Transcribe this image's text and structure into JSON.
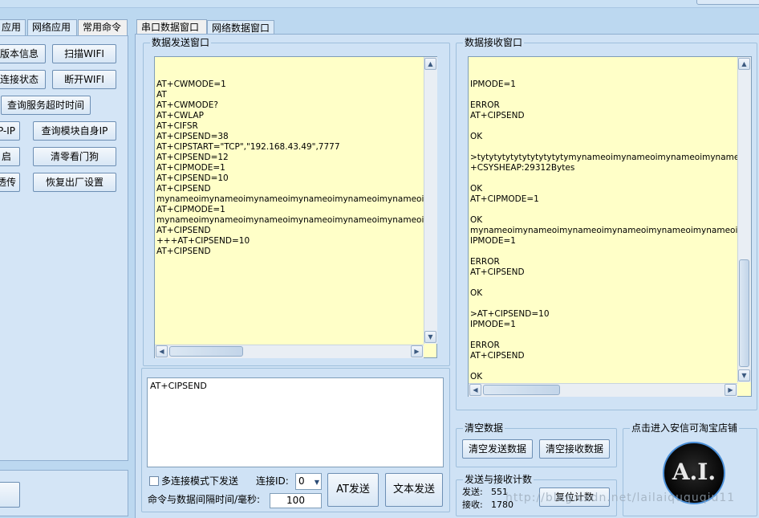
{
  "left_tabs": [
    "应用",
    "网络应用",
    "常用命令"
  ],
  "left_buttons": [
    "版本信息",
    "扫描WIFI",
    "连接状态",
    "断开WIFI",
    "查询服务超时时间",
    "P-IP",
    "查询模块自身IP",
    "启",
    "清零看门狗",
    "透传",
    "恢复出厂设置"
  ],
  "main_tabs": [
    "串口数据窗口",
    "网络数据窗口"
  ],
  "send_group": {
    "title": "数据发送窗口",
    "lines": [
      "AT+CWMODE=1",
      "AT",
      "AT+CWMODE?",
      "AT+CWLAP",
      "AT+CIFSR",
      "AT+CIPSEND=38",
      "AT+CIPSTART=\"TCP\",\"192.168.43.49\",7777",
      "AT+CIPSEND=12",
      "AT+CIPMODE=1",
      "AT+CIPSEND=10",
      "AT+CIPSEND",
      "mynameoimynameoimynameoimynameoimynameoimynameoi+++mynam",
      "AT+CIPMODE=1",
      "mynameoimynameoimynameoimynameoimynameoimynameoi",
      "AT+CIPSEND",
      "+++AT+CIPSEND=10",
      "AT+CIPSEND",
      ""
    ]
  },
  "receive_group": {
    "title": "数据接收窗口",
    "lines": [
      "IPMODE=1",
      "",
      "ERROR",
      "AT+CIPSEND",
      "",
      "OK",
      "",
      ">tytytytytytytytytytytymynameoimynameoimynameoimynameoimyname",
      "+CSYSHEAP:29312Bytes",
      "",
      "OK",
      "AT+CIPMODE=1",
      "",
      "OK",
      "mynameoimynameoimynameoimynameoimynameoimynameoimynameoi",
      "IPMODE=1",
      "",
      "ERROR",
      "AT+CIPSEND",
      "",
      "OK",
      "",
      ">AT+CIPSEND=10",
      "IPMODE=1",
      "",
      "ERROR",
      "AT+CIPSEND",
      "",
      "OK",
      "",
      "",
      ">"
    ]
  },
  "command_box": {
    "value": "AT+CIPSEND"
  },
  "multi_conn": {
    "label": "多连接模式下发送",
    "checked": false
  },
  "conn_id": {
    "label": "连接ID:",
    "value": "0"
  },
  "interval": {
    "label": "命令与数据间隔时间/毫秒:",
    "value": "100"
  },
  "buttons": {
    "at_send": "AT发送",
    "text_send": "文本发送",
    "clear_send": "清空发送数据",
    "clear_recv": "清空接收数据",
    "reset_count": "复位计数"
  },
  "clear_group": {
    "title": "清空数据"
  },
  "count_group": {
    "title": "发送与接收计数",
    "send_label": "发送:",
    "send_value": "551",
    "recv_label": "接收:",
    "recv_value": "1780"
  },
  "store_group": {
    "title": "点击进入安信可淘宝店铺",
    "logo_text": "A.I."
  },
  "watermark": "http://blog.csdn.net/lailaiququqiu11",
  "colors": {
    "textarea_bg": "#ffffc8",
    "window_bg": "#cfe2f5",
    "border": "#8faecf"
  }
}
